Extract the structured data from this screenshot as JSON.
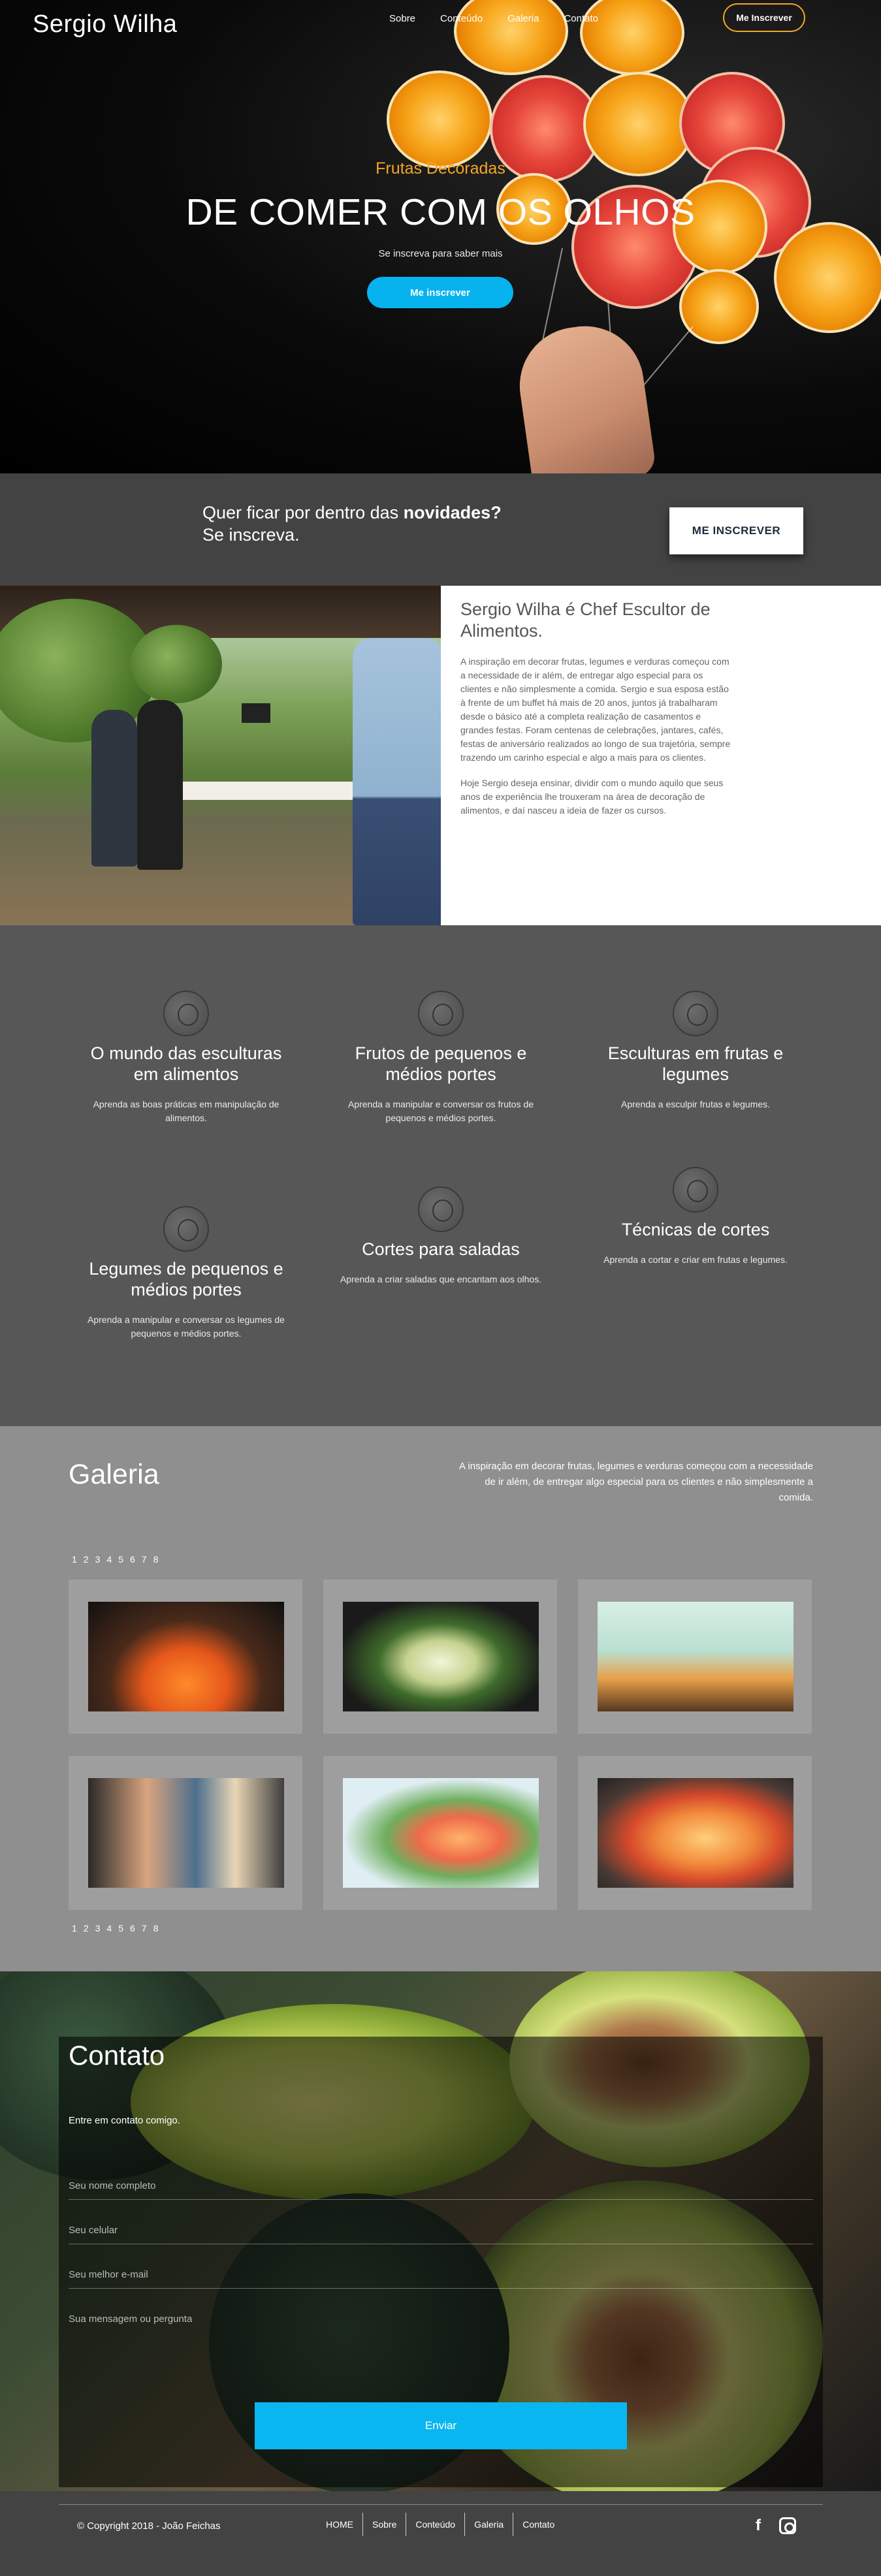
{
  "header": {
    "logo": "Sergio Wilha",
    "menu": [
      "Sobre",
      "Conteúdo",
      "Galeria",
      "Contato"
    ],
    "cta": "Me Inscrever"
  },
  "hero": {
    "subtitle": "Frutas Decoradas",
    "title": "DE COMER COM OS OLHOS",
    "description": "Se inscreva para saber mais",
    "button": "Me inscrever"
  },
  "newsletter": {
    "line1_prefix": "Quer ficar por dentro das ",
    "line1_bold": "novidades?",
    "line2": "Se inscreva.",
    "button": "ME INSCREVER"
  },
  "about": {
    "title": "Sergio Wilha é Chef Escultor de Alimentos.",
    "paragraph1": "A inspiração em decorar frutas, legumes e verduras começou com a necessidade de ir além, de entregar algo especial para os clientes e não simplesmente a comida. Sergio e sua esposa estão à frente de um buffet há mais de 20 anos, juntos já trabalharam desde o básico até a completa realização de casamentos e grandes festas. Foram centenas de celebrações, jantares, cafés, festas de aniversário realizados ao longo de sua trajetória, sempre trazendo um carinho especial e algo a mais para os clientes.",
    "paragraph2": "Hoje Sergio deseja ensinar, dividir com o mundo aquilo que seus anos de experiência lhe trouxeram na área de decoração de alimentos, e daí nasceu a ideia de fazer os cursos."
  },
  "skills": [
    {
      "title": "O mundo das esculturas em alimentos",
      "desc": "Aprenda as boas práticas em manipulação de alimentos.",
      "icon": "avocado-icon"
    },
    {
      "title": "Frutos de pequenos e médios portes",
      "desc": "Aprenda a manipular e conversar os frutos de pequenos e médios portes.",
      "icon": "fruits-icon"
    },
    {
      "title": "Esculturas em frutas e legumes",
      "desc": "Aprenda a esculpir frutas e legumes.",
      "icon": "melon-icon"
    },
    {
      "title": "Legumes de pequenos e médios portes",
      "desc": "Aprenda a manipular e conversar os legumes de pequenos e médios portes.",
      "icon": "tomato-icon"
    },
    {
      "title": "Cortes para saladas",
      "desc": "Aprenda a criar saladas que encantam aos olhos.",
      "icon": "strawberry-icon"
    },
    {
      "title": "Técnicas de cortes",
      "desc": "Aprenda a cortar e criar em frutas e legumes.",
      "icon": "pineapple-icon"
    }
  ],
  "gallery": {
    "title": "Galeria",
    "description": "A inspiração em decorar frutas, legumes e verduras começou com a necessidade de ir além, de entregar algo especial para os clientes e não simplesmente a comida.",
    "pages": [
      "1",
      "2",
      "3",
      "4",
      "5",
      "6",
      "7",
      "8"
    ]
  },
  "contact": {
    "title": "Contato",
    "intro": "Entre em contato comigo.",
    "name_placeholder": "Seu nome completo",
    "phone_placeholder": "Seu celular",
    "email_placeholder": "Seu melhor e-mail",
    "message_placeholder": "Sua mensagem ou pergunta",
    "send": "Enviar"
  },
  "footer": {
    "copyright": "© Copyright 2018 - João Feichas",
    "links": [
      "HOME",
      "Sobre",
      "Conteúdo",
      "Galeria",
      "Contato"
    ],
    "social": [
      "facebook-icon",
      "instagram-icon"
    ]
  },
  "colors": {
    "accent_orange": "#f5a623",
    "accent_blue": "#07b3ee",
    "dark_band": "#434343",
    "gray_section": "#575757",
    "gallery_bg": "#8f8f8f"
  }
}
